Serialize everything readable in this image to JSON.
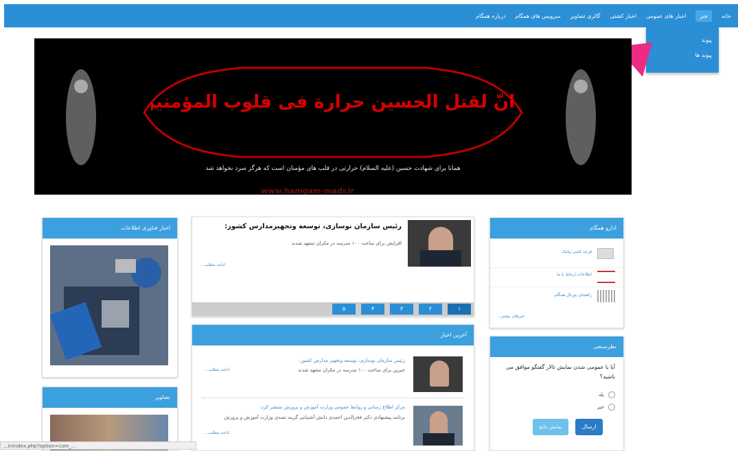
{
  "nav": {
    "items": [
      "خانه",
      "خبر",
      "اخبار های عمومی",
      "اخبار کشتی",
      "گالری تصاویر",
      "سرویس های همگام",
      "درباره همگام"
    ]
  },
  "dropdown": {
    "items": [
      "پیوند",
      "پیوند ها"
    ]
  },
  "banner": {
    "calligraphy": "انّ لقتل الحسین حرارة فی قلوب المؤمنین لن تبرد ابدا",
    "subtitle": "همانا برای شهادت حسین (علیه السلام) حرارتی در قلب های مؤمنان است که هرگز سرد نخواهد شد",
    "watermark": "www.hamgam-madr.ir"
  },
  "left_panels": {
    "news_title": "اخبار فناوری اطلاعات",
    "gallery_title": "تصاویر"
  },
  "center": {
    "slider": {
      "headline": "رئیس سازمان نوسازی، توسعه وتجهیزمدارس کشور:",
      "text": "افزایش برای ساخت ۱۰۰ مدرسه در مکران متعهد شدند",
      "more": "ادامه مطلب...",
      "pages": [
        "۵",
        "۴",
        "۳",
        "۲",
        "۱"
      ]
    },
    "latest": {
      "title": "آخرین اخبار",
      "items": [
        {
          "title": "رئیس سازمان نوسازی، توسعه وتجهیز مدارس کشور:",
          "text": "خیرین برای ساخت ۱۰۰ مدرسه در مکران متعهد شدند",
          "more": "ادامه مطلب..."
        },
        {
          "title": "مرکز اطلاع رسانی و روابط عمومی وزارت آموزش و پرورش منتشر کرد:",
          "text": "برنامه پیشنهادی دکتر فخرالدین احمدی دانش آشتیانی گزینه تصدی وزارت آموزش و پرورش",
          "more": "ادامه مطلب..."
        }
      ]
    }
  },
  "right": {
    "hamgam": {
      "title": "ادارو همگام",
      "rows": [
        "قرعه کشی پیامک",
        "اطلاعات ارتباط با ما",
        "راهنمای پورتال همگام"
      ],
      "archive": "خبرهای بیشتر..."
    },
    "poll": {
      "title": "نظرسنجی",
      "question": "آیا با عمومی شدن نمایش تالار گفتگو موافق می باشید؟",
      "options": [
        "بله",
        "خیر"
      ],
      "submit": "ارسال",
      "results": "نمایش نتایج"
    }
  },
  "status": {
    "url": "...ir/index.php?option=com_..."
  }
}
